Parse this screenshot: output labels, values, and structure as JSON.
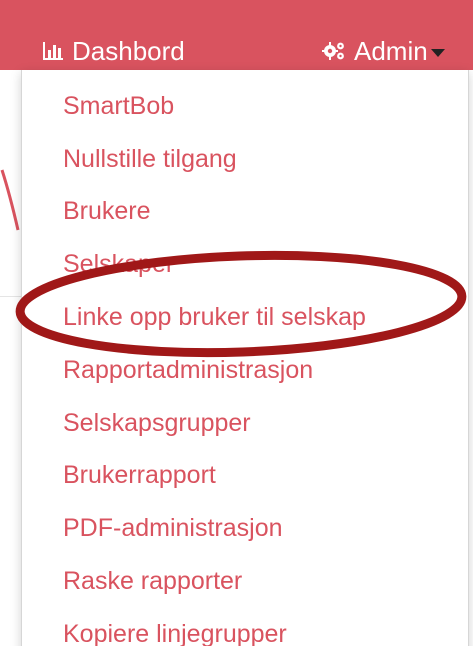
{
  "navbar": {
    "dashboard_label": "Dashbord",
    "dashboard_icon": "bar-chart-icon",
    "admin_label": "Admin",
    "admin_icon": "gears-icon",
    "background_color": "#d9535f"
  },
  "dropdown": {
    "items": [
      {
        "label": "SmartBob"
      },
      {
        "label": "Nullstille tilgang"
      },
      {
        "label": "Brukere"
      },
      {
        "label": "Selskaper"
      },
      {
        "label": "Linke opp bruker til selskap"
      },
      {
        "label": "Rapportadministrasjon"
      },
      {
        "label": "Selskapsgrupper"
      },
      {
        "label": "Brukerrapport"
      },
      {
        "label": "PDF-administrasjon"
      },
      {
        "label": "Raske rapporter"
      },
      {
        "label": "Kopiere linjegrupper"
      }
    ],
    "text_color": "#d9535f"
  },
  "annotation": {
    "color": "#a01818",
    "target_item": "Linke opp bruker til selskap"
  }
}
